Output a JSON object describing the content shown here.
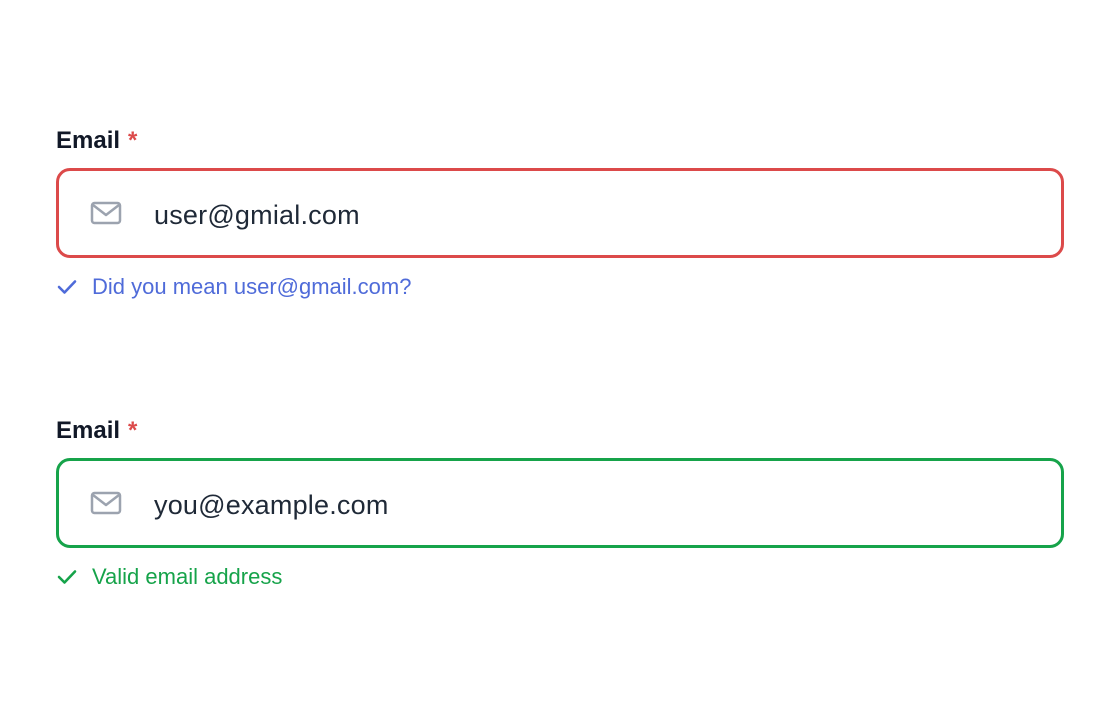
{
  "fields": [
    {
      "label": "Email",
      "required_marker": "*",
      "value": "user@gmial.com",
      "state": "invalid",
      "border_color": "#dc4a4a",
      "icon": "mail-icon",
      "helper_icon": "check-icon",
      "helper_text": "Did you mean user@gmail.com?",
      "helper_color": "#4f6bd9"
    },
    {
      "label": "Email",
      "required_marker": "*",
      "value": "you@example.com",
      "state": "valid",
      "border_color": "#16a34a",
      "icon": "mail-icon",
      "helper_icon": "check-icon",
      "helper_text": "Valid email address",
      "helper_color": "#16a34a"
    }
  ]
}
